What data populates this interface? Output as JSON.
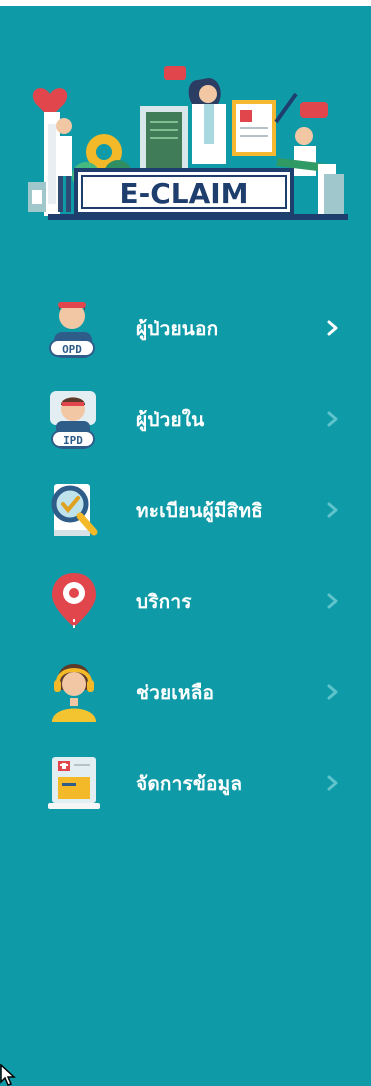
{
  "app": {
    "logo_text": "E-CLAIM"
  },
  "menu": {
    "items": [
      {
        "label": "ผู้ป่วยนอก",
        "icon": "opd-patient-icon",
        "badge": "OPD",
        "active": true
      },
      {
        "label": "ผู้ป่วยใน",
        "icon": "ipd-patient-icon",
        "badge": "IPD",
        "active": false
      },
      {
        "label": "ทะเบียนผู้มีสิทธิ",
        "icon": "registry-search-icon",
        "active": false
      },
      {
        "label": "บริการ",
        "icon": "location-pin-icon",
        "active": false
      },
      {
        "label": "ช่วยเหลือ",
        "icon": "support-agent-icon",
        "active": false
      },
      {
        "label": "จัดการข้อมูล",
        "icon": "data-management-icon",
        "active": false
      }
    ]
  },
  "colors": {
    "background": "#0f9aa8",
    "chevron_active": "#ffffff",
    "chevron_inactive": "#5fc3cc",
    "logo_navy": "#1e3f6e"
  }
}
